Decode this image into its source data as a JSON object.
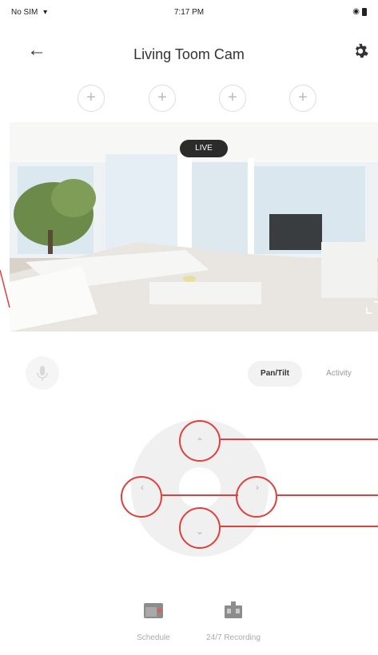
{
  "status_bar": {
    "carrier": "No SIM",
    "time": "7:17 PM"
  },
  "nav": {
    "title": "Living Toom Cam",
    "back_icon": "arrow-left-icon",
    "settings_icon": "gear-icon"
  },
  "presets": {
    "add_symbol": "+"
  },
  "video": {
    "badge": "LIVE"
  },
  "tabs": [
    {
      "label": "Pan/Tilt"
    },
    {
      "label": "Activity"
    }
  ],
  "dpad": {
    "up": "⌃",
    "down": "⌄",
    "left": "‹",
    "right": "›"
  },
  "bottom_bar": [
    {
      "label": "Schedule",
      "icon": "calendar-icon"
    },
    {
      "label": "24/7 Recording",
      "icon": "recording-icon"
    }
  ],
  "colors": {
    "accent": "#e0403c",
    "muted_text": "#999999"
  }
}
